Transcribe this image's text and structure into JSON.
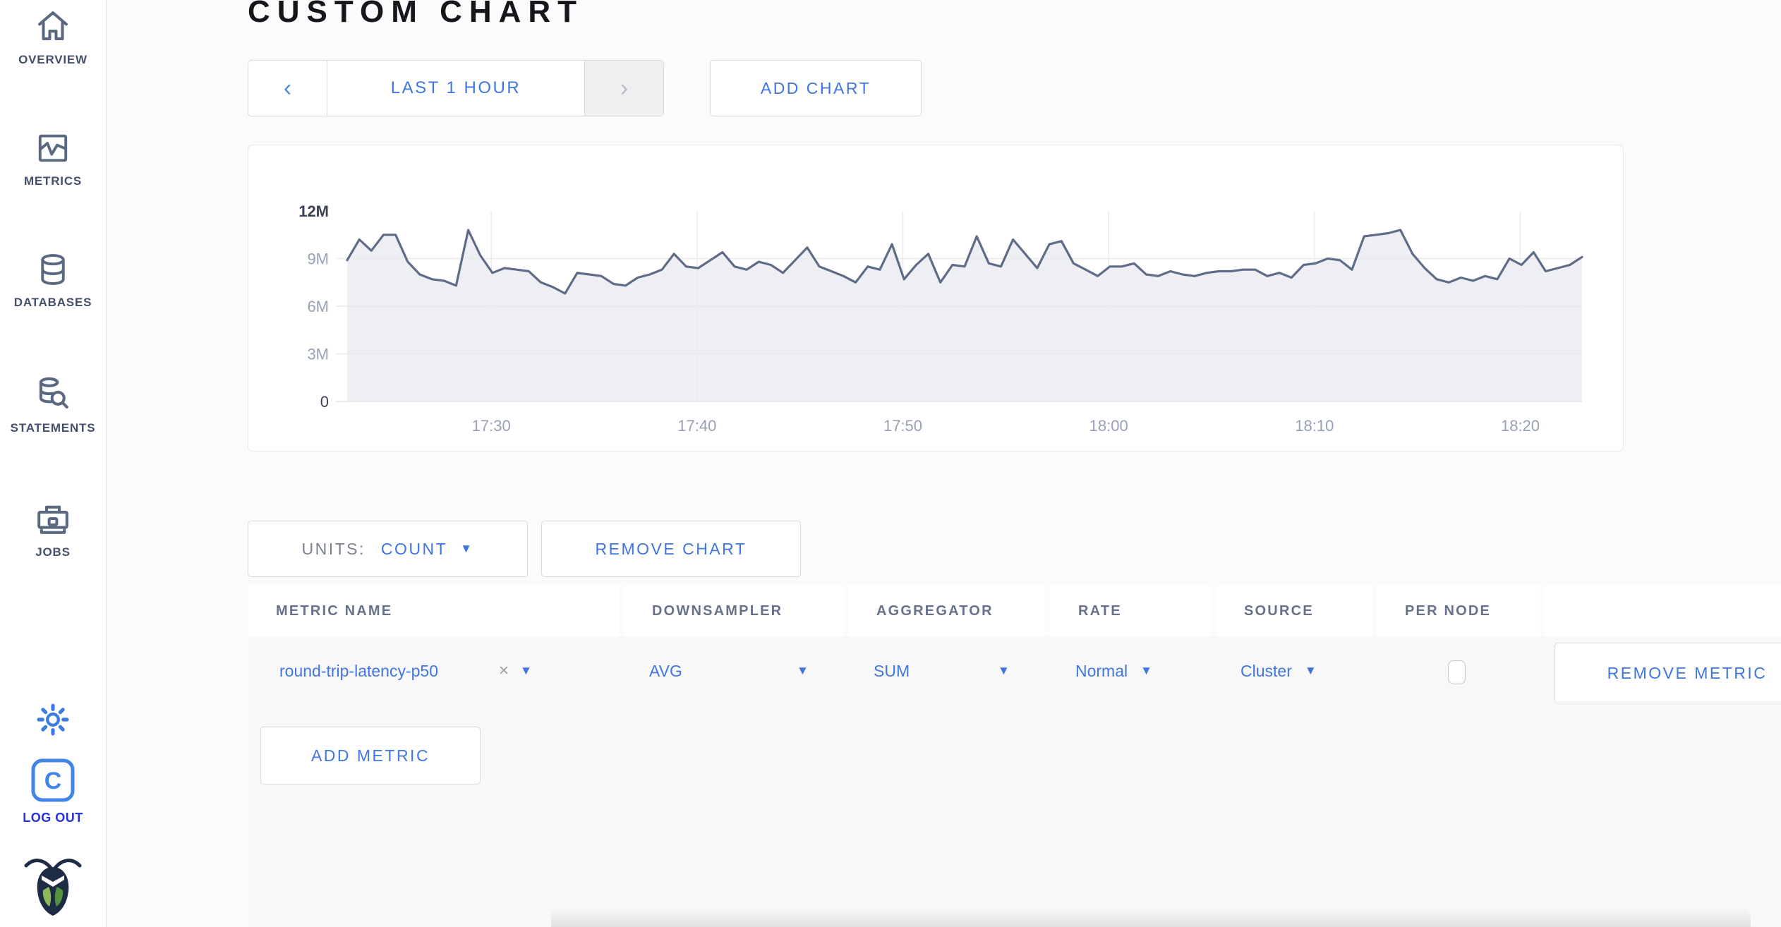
{
  "page": {
    "title": "CUSTOM CHART"
  },
  "colors": {
    "accent_blue": "#4076df",
    "slate_icon": "#5a6980",
    "logout_blue": "#2531e0",
    "chart_line": "#5f6c87",
    "chart_fill": "#edeff4"
  },
  "sidebar": {
    "items": [
      {
        "label": "OVERVIEW",
        "icon": "home-icon"
      },
      {
        "label": "METRICS",
        "icon": "metrics-graph-icon"
      },
      {
        "label": "DATABASES",
        "icon": "database-icon"
      },
      {
        "label": "STATEMENTS",
        "icon": "database-search-icon"
      },
      {
        "label": "JOBS",
        "icon": "briefcase-icon"
      }
    ],
    "settings_icon": "gear-icon",
    "logout": {
      "label": "LOG OUT",
      "icon": "cockroach-c-logo"
    },
    "brand_icon": "cockroach-logo"
  },
  "toolbar": {
    "prev_arrow": "‹",
    "time_range_label": "LAST 1 HOUR",
    "next_arrow": "›",
    "add_chart_label": "ADD CHART"
  },
  "chart_controls": {
    "units_label": "UNITS:",
    "units_value": "COUNT",
    "remove_chart_label": "REMOVE CHART",
    "add_metric_label": "ADD METRIC"
  },
  "table": {
    "headers": [
      "METRIC NAME",
      "DOWNSAMPLER",
      "AGGREGATOR",
      "RATE",
      "SOURCE",
      "PER NODE"
    ],
    "row": {
      "metric_name": "round-trip-latency-p50",
      "remove_x": "×",
      "downsampler": "AVG",
      "aggregator": "SUM",
      "rate": "Normal",
      "source": "Cluster",
      "per_node_checked": false,
      "remove_metric_label": "REMOVE METRIC"
    }
  },
  "chart_data": {
    "type": "area",
    "title": "",
    "xlabel": "",
    "ylabel": "count",
    "x_domain": [
      "17:23",
      "18:23"
    ],
    "x_ticks": [
      "17:30",
      "17:40",
      "17:50",
      "18:00",
      "18:10",
      "18:20"
    ],
    "y_ticks": [
      {
        "label": "0",
        "value_millions": 0
      },
      {
        "label": "3M",
        "value_millions": 3
      },
      {
        "label": "6M",
        "value_millions": 6
      },
      {
        "label": "9M",
        "value_millions": 9
      },
      {
        "label": "12M",
        "value_millions": 12
      }
    ],
    "ylim_millions": [
      0,
      12
    ],
    "grid": true,
    "legend": "none",
    "series": [
      {
        "name": "round-trip-latency-p50",
        "downsampler": "AVG",
        "aggregator": "SUM",
        "rate": "Normal",
        "source": "Cluster",
        "values_millions": [
          8.9,
          10.2,
          9.5,
          10.5,
          10.5,
          8.8,
          8.0,
          7.7,
          7.6,
          7.3,
          10.8,
          9.2,
          8.1,
          8.4,
          8.3,
          8.2,
          7.5,
          7.2,
          6.8,
          8.1,
          8.0,
          7.9,
          7.4,
          7.3,
          7.8,
          8.0,
          8.3,
          9.3,
          8.5,
          8.4,
          8.9,
          9.4,
          8.5,
          8.3,
          8.8,
          8.6,
          8.1,
          8.9,
          9.7,
          8.5,
          8.2,
          7.9,
          7.5,
          8.5,
          8.3,
          9.9,
          7.7,
          8.6,
          9.3,
          7.5,
          8.6,
          8.5,
          10.4,
          8.7,
          8.5,
          10.2,
          9.3,
          8.4,
          9.9,
          10.1,
          8.7,
          8.3,
          7.9,
          8.5,
          8.5,
          8.7,
          8.0,
          7.9,
          8.2,
          8.0,
          7.9,
          8.1,
          8.2,
          8.2,
          8.3,
          8.3,
          7.9,
          8.1,
          7.8,
          8.6,
          8.7,
          9.0,
          8.9,
          8.3,
          10.4,
          10.5,
          10.6,
          10.8,
          9.3,
          8.4,
          7.7,
          7.5,
          7.8,
          7.6,
          7.9,
          7.7,
          9.0,
          8.6,
          9.4,
          8.2,
          8.4,
          8.6,
          9.1
        ]
      }
    ]
  }
}
